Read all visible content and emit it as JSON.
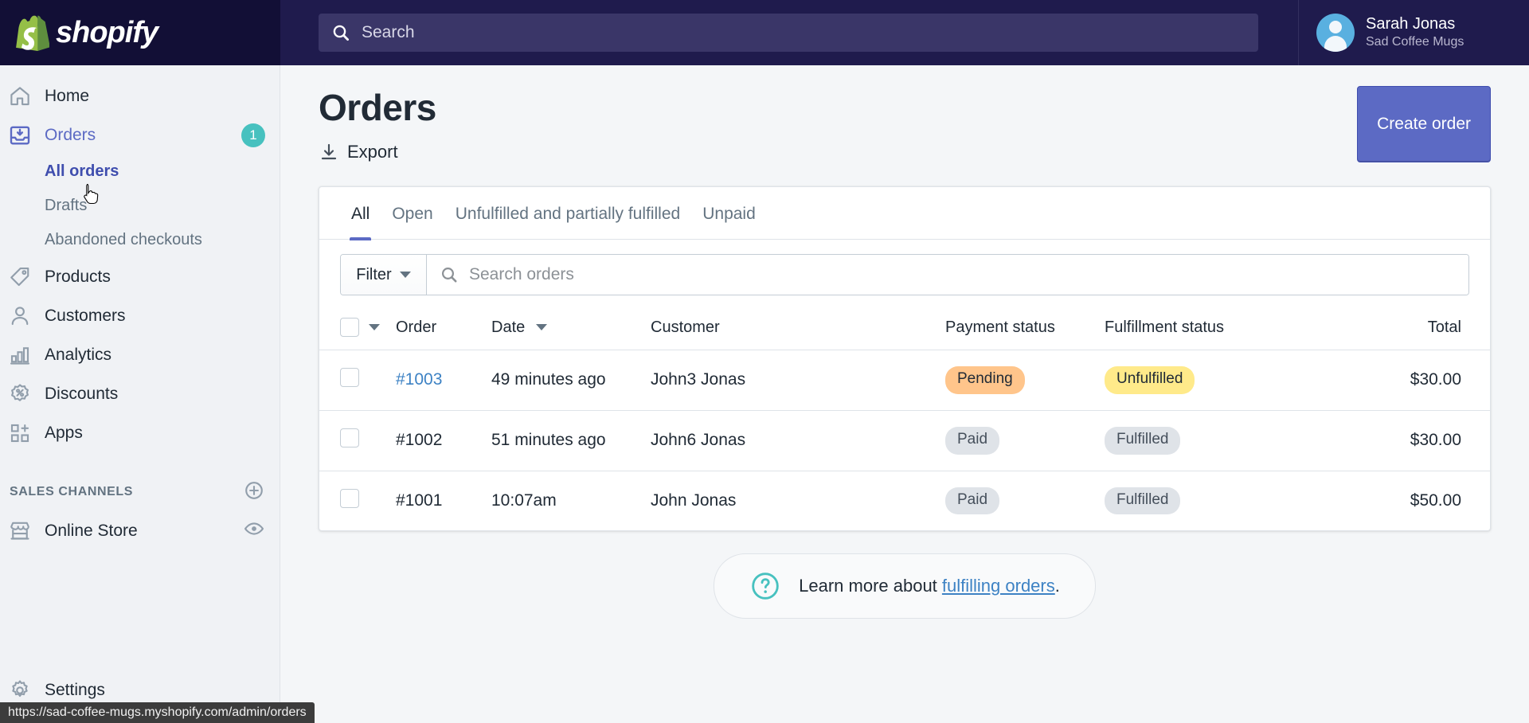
{
  "topbar": {
    "brand": "shopify",
    "search": {
      "placeholder": "Search",
      "value": "",
      "icon": "search-icon"
    },
    "profile": {
      "name": "Sarah Jonas",
      "store": "Sad Coffee Mugs"
    }
  },
  "sidebar": {
    "items": [
      {
        "label": "Home",
        "icon": "home-icon",
        "active": false
      },
      {
        "label": "Orders",
        "icon": "orders-inbox-icon",
        "active": true,
        "badge": "1"
      },
      {
        "label": "Products",
        "icon": "tag-icon",
        "active": false
      },
      {
        "label": "Customers",
        "icon": "person-icon",
        "active": false
      },
      {
        "label": "Analytics",
        "icon": "bar-chart-icon",
        "active": false
      },
      {
        "label": "Discounts",
        "icon": "discount-percent-icon",
        "active": false
      },
      {
        "label": "Apps",
        "icon": "apps-grid-plus-icon",
        "active": false
      }
    ],
    "sub_items": [
      {
        "label": "All orders",
        "current": true
      },
      {
        "label": "Drafts",
        "current": false
      },
      {
        "label": "Abandoned checkouts",
        "current": false
      }
    ],
    "sales_channels": {
      "title": "SALES CHANNELS",
      "add_icon": "plus-circle-icon",
      "items": [
        {
          "label": "Online Store",
          "icon": "storefront-icon",
          "action_icon": "eye-icon"
        }
      ]
    },
    "settings": {
      "label": "Settings",
      "icon": "gear-icon"
    }
  },
  "main": {
    "title": "Orders",
    "export_label": "Export",
    "export_icon": "download-icon",
    "create_order_label": "Create order",
    "tabs": [
      {
        "label": "All",
        "active": true
      },
      {
        "label": "Open",
        "active": false
      },
      {
        "label": "Unfulfilled and partially fulfilled",
        "active": false
      },
      {
        "label": "Unpaid",
        "active": false
      }
    ],
    "filter": {
      "label": "Filter",
      "icon": "chevron-down-icon"
    },
    "search_orders": {
      "placeholder": "Search orders",
      "value": "",
      "icon": "search-icon"
    },
    "table": {
      "columns": [
        "Order",
        "Date",
        "Customer",
        "Payment status",
        "Fulfillment status",
        "Total"
      ],
      "sorted_column": "Date",
      "rows": [
        {
          "order": "#1003",
          "date": "49 minutes ago",
          "customer": "John3 Jonas",
          "payment_status": "Pending",
          "payment_style": "pending",
          "fulfillment_status": "Unfulfilled",
          "fulfillment_style": "unfulfilled",
          "total": "$30.00",
          "is_link": true
        },
        {
          "order": "#1002",
          "date": "51 minutes ago",
          "customer": "John6 Jonas",
          "payment_status": "Paid",
          "payment_style": "paid",
          "fulfillment_status": "Fulfilled",
          "fulfillment_style": "fulfilled",
          "total": "$30.00",
          "is_link": false
        },
        {
          "order": "#1001",
          "date": "10:07am",
          "customer": "John Jonas",
          "payment_status": "Paid",
          "payment_style": "paid",
          "fulfillment_status": "Fulfilled",
          "fulfillment_style": "fulfilled",
          "total": "$50.00",
          "is_link": false
        }
      ]
    },
    "footer_help": {
      "icon": "question-circle-icon",
      "text": "Learn more about ",
      "link": "fulfilling orders",
      "suffix": "."
    }
  },
  "statusbar": {
    "url": "https://sad-coffee-mugs.myshopify.com/admin/orders"
  },
  "colors": {
    "topbar_bg": "#1f1b4d",
    "logo_bg": "#120f36",
    "accent_purple": "#5c6ac4",
    "badge_teal": "#47c1bf",
    "link_blue": "#3d82c4",
    "pill_pending": "#ffc58b",
    "pill_unfulfilled": "#ffea8a",
    "pill_grey": "#dfe3e8"
  }
}
